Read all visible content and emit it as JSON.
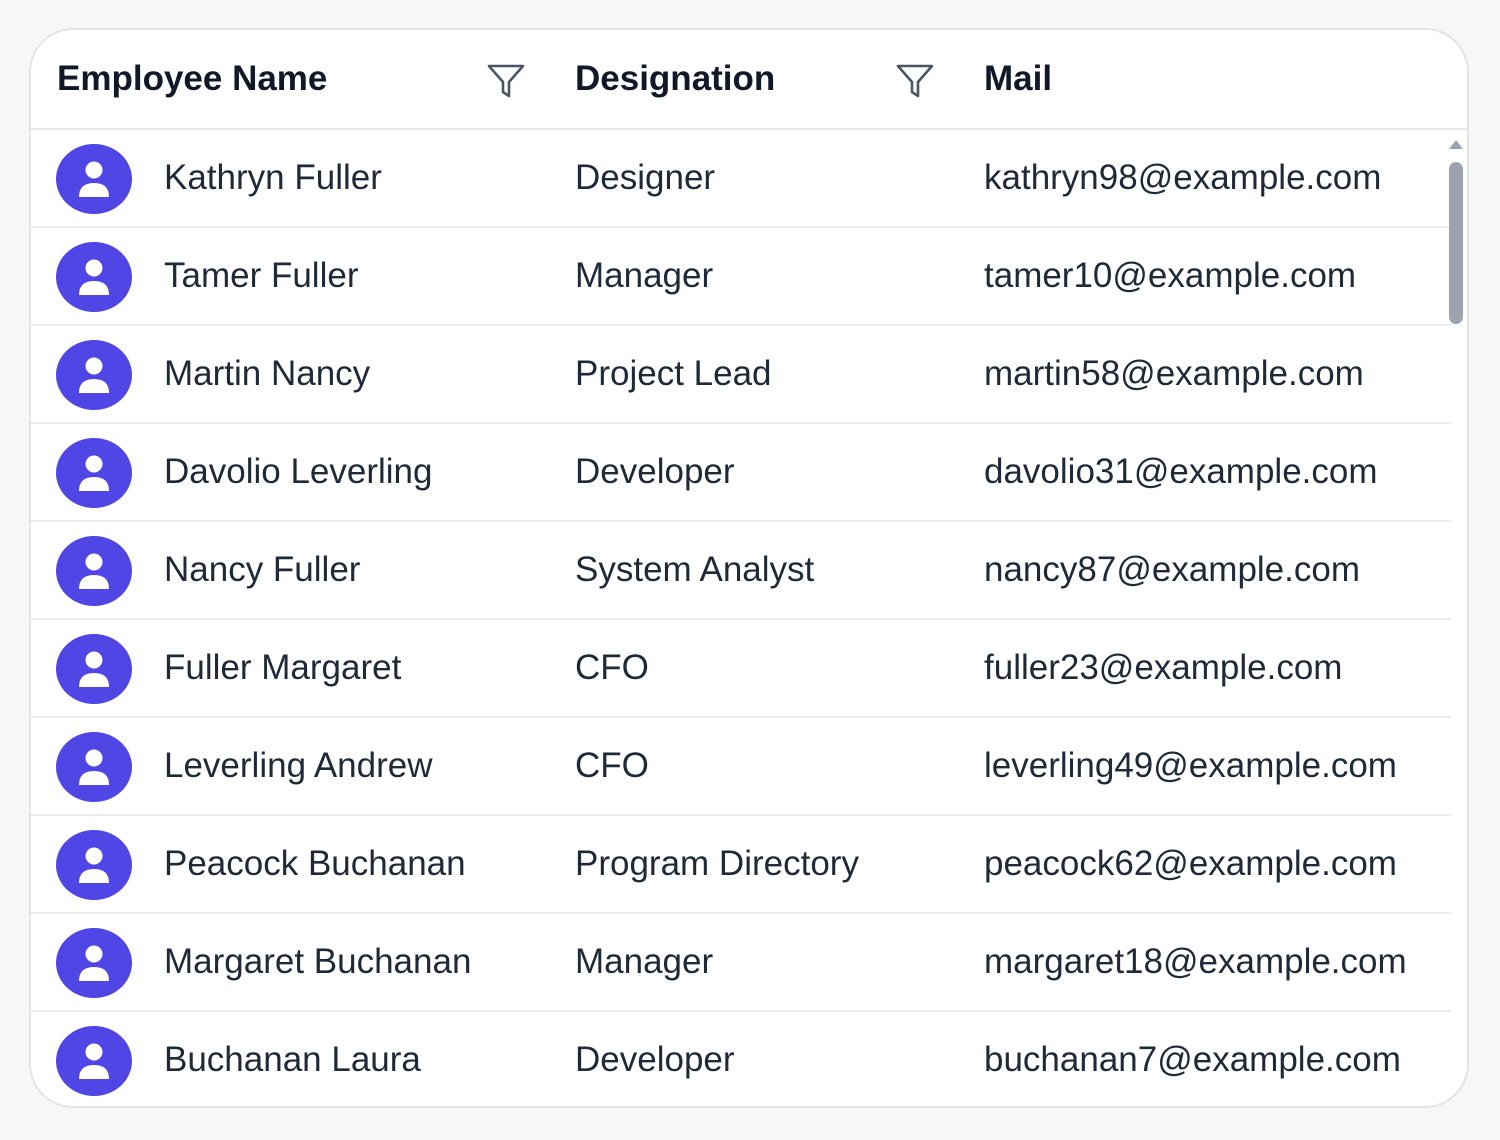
{
  "columns": {
    "name": "Employee Name",
    "designation": "Designation",
    "mail": "Mail"
  },
  "icons": {
    "filter": "filter-icon",
    "avatar": "user-icon"
  },
  "colors": {
    "avatar_bg": "#4f46e5",
    "text": "#1f2937",
    "header_text": "#111827",
    "border": "#e4e4e7"
  },
  "rows": [
    {
      "name": "Kathryn Fuller",
      "designation": "Designer",
      "mail": "kathryn98@example.com"
    },
    {
      "name": "Tamer Fuller",
      "designation": "Manager",
      "mail": "tamer10@example.com"
    },
    {
      "name": "Martin Nancy",
      "designation": "Project Lead",
      "mail": "martin58@example.com"
    },
    {
      "name": "Davolio Leverling",
      "designation": "Developer",
      "mail": "davolio31@example.com"
    },
    {
      "name": "Nancy Fuller",
      "designation": "System Analyst",
      "mail": "nancy87@example.com"
    },
    {
      "name": "Fuller Margaret",
      "designation": "CFO",
      "mail": "fuller23@example.com"
    },
    {
      "name": "Leverling Andrew",
      "designation": "CFO",
      "mail": "leverling49@example.com"
    },
    {
      "name": "Peacock Buchanan",
      "designation": "Program Directory",
      "mail": "peacock62@example.com"
    },
    {
      "name": "Margaret Buchanan",
      "designation": "Manager",
      "mail": "margaret18@example.com"
    },
    {
      "name": "Buchanan Laura",
      "designation": "Developer",
      "mail": "buchanan7@example.com"
    }
  ]
}
